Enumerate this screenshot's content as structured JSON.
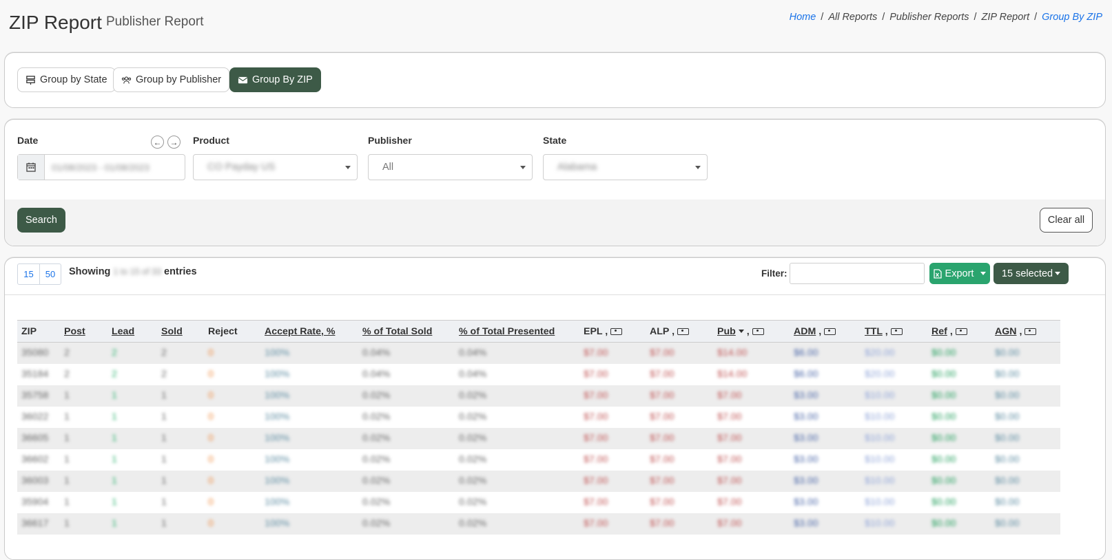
{
  "header": {
    "title": "ZIP Report",
    "subtitle": "Publisher Report",
    "breadcrumb": [
      "Home",
      "All Reports",
      "Publisher Reports",
      "ZIP Report",
      "Group By ZIP"
    ]
  },
  "groups": {
    "state": "Group by State",
    "publisher": "Group by Publisher",
    "zip": "Group By ZIP"
  },
  "filters": {
    "date_label": "Date",
    "date_value": "01/08/2023 - 01/08/2023",
    "product_label": "Product",
    "product_value": "CO Payday US",
    "publisher_label": "Publisher",
    "publisher_value": "All",
    "state_label": "State",
    "state_value": "Alabama",
    "search": "Search",
    "clear": "Clear all"
  },
  "table_controls": {
    "page_sizes": [
      "15",
      "50"
    ],
    "showing_prefix": "Showing",
    "showing_range": "1 to 15 of 33",
    "showing_suffix": "entries",
    "filter_label": "Filter:",
    "export": "Export",
    "selected": "15 selected"
  },
  "table": {
    "columns": [
      "ZIP",
      "Post",
      "Lead",
      "Sold",
      "Reject",
      "Accept Rate, %",
      "% of Total Sold",
      "% of Total Presented",
      "EPL",
      "ALP",
      "Pub",
      "ADM",
      "TTL",
      "Ref",
      "AGN"
    ],
    "rows": [
      [
        "35080",
        "2",
        "2",
        "2",
        "0",
        "100%",
        "0.04%",
        "0.04%",
        "$7.00",
        "$7.00",
        "$14.00",
        "$6.00",
        "$20.00",
        "$0.00",
        "$0.00"
      ],
      [
        "35184",
        "2",
        "2",
        "2",
        "0",
        "100%",
        "0.04%",
        "0.04%",
        "$7.00",
        "$7.00",
        "$14.00",
        "$6.00",
        "$20.00",
        "$0.00",
        "$0.00"
      ],
      [
        "35758",
        "1",
        "1",
        "1",
        "0",
        "100%",
        "0.02%",
        "0.02%",
        "$7.00",
        "$7.00",
        "$7.00",
        "$3.00",
        "$10.00",
        "$0.00",
        "$0.00"
      ],
      [
        "36022",
        "1",
        "1",
        "1",
        "0",
        "100%",
        "0.02%",
        "0.02%",
        "$7.00",
        "$7.00",
        "$7.00",
        "$3.00",
        "$10.00",
        "$0.00",
        "$0.00"
      ],
      [
        "36605",
        "1",
        "1",
        "1",
        "0",
        "100%",
        "0.02%",
        "0.02%",
        "$7.00",
        "$7.00",
        "$7.00",
        "$3.00",
        "$10.00",
        "$0.00",
        "$0.00"
      ],
      [
        "36602",
        "1",
        "1",
        "1",
        "0",
        "100%",
        "0.02%",
        "0.02%",
        "$7.00",
        "$7.00",
        "$7.00",
        "$3.00",
        "$10.00",
        "$0.00",
        "$0.00"
      ],
      [
        "36003",
        "1",
        "1",
        "1",
        "0",
        "100%",
        "0.02%",
        "0.02%",
        "$7.00",
        "$7.00",
        "$7.00",
        "$3.00",
        "$10.00",
        "$0.00",
        "$0.00"
      ],
      [
        "35904",
        "1",
        "1",
        "1",
        "0",
        "100%",
        "0.02%",
        "0.02%",
        "$7.00",
        "$7.00",
        "$7.00",
        "$3.00",
        "$10.00",
        "$0.00",
        "$0.00"
      ],
      [
        "36617",
        "1",
        "1",
        "1",
        "0",
        "100%",
        "0.02%",
        "0.02%",
        "$7.00",
        "$7.00",
        "$7.00",
        "$3.00",
        "$10.00",
        "$0.00",
        "$0.00"
      ]
    ]
  }
}
